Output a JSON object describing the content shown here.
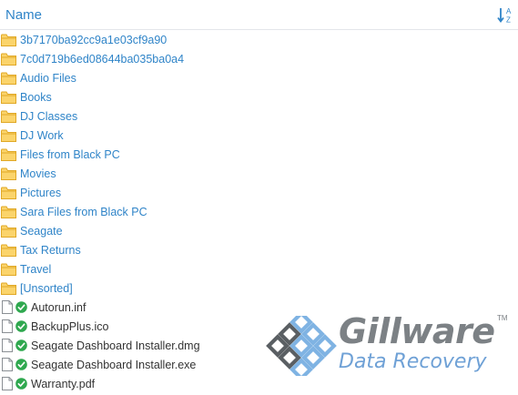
{
  "header": {
    "title": "Name",
    "sort_icon": "sort-alpha-asc-icon"
  },
  "colors": {
    "accent": "#2f84c8",
    "folder": "#f6c14a",
    "folder_border": "#e0a826",
    "check": "#2fa84f",
    "file_text": "#333333"
  },
  "folders": [
    {
      "label": "3b7170ba92cc9a1e03cf9a90"
    },
    {
      "label": "7c0d719b6ed08644ba035ba0a4"
    },
    {
      "label": "Audio Files"
    },
    {
      "label": "Books"
    },
    {
      "label": "DJ Classes"
    },
    {
      "label": "DJ Work"
    },
    {
      "label": "Files from Black PC"
    },
    {
      "label": "Movies"
    },
    {
      "label": "Pictures"
    },
    {
      "label": "Sara Files from Black PC"
    },
    {
      "label": "Seagate"
    },
    {
      "label": "Tax Returns"
    },
    {
      "label": "Travel"
    },
    {
      "label": "[Unsorted]"
    }
  ],
  "files": [
    {
      "label": "Autorun.inf"
    },
    {
      "label": "BackupPlus.ico"
    },
    {
      "label": "Seagate Dashboard Installer.dmg"
    },
    {
      "label": "Seagate Dashboard Installer.exe"
    },
    {
      "label": "Warranty.pdf"
    }
  ],
  "watermark": {
    "title": "Gillware",
    "trademark": "TM",
    "subtitle": "Data Recovery"
  }
}
